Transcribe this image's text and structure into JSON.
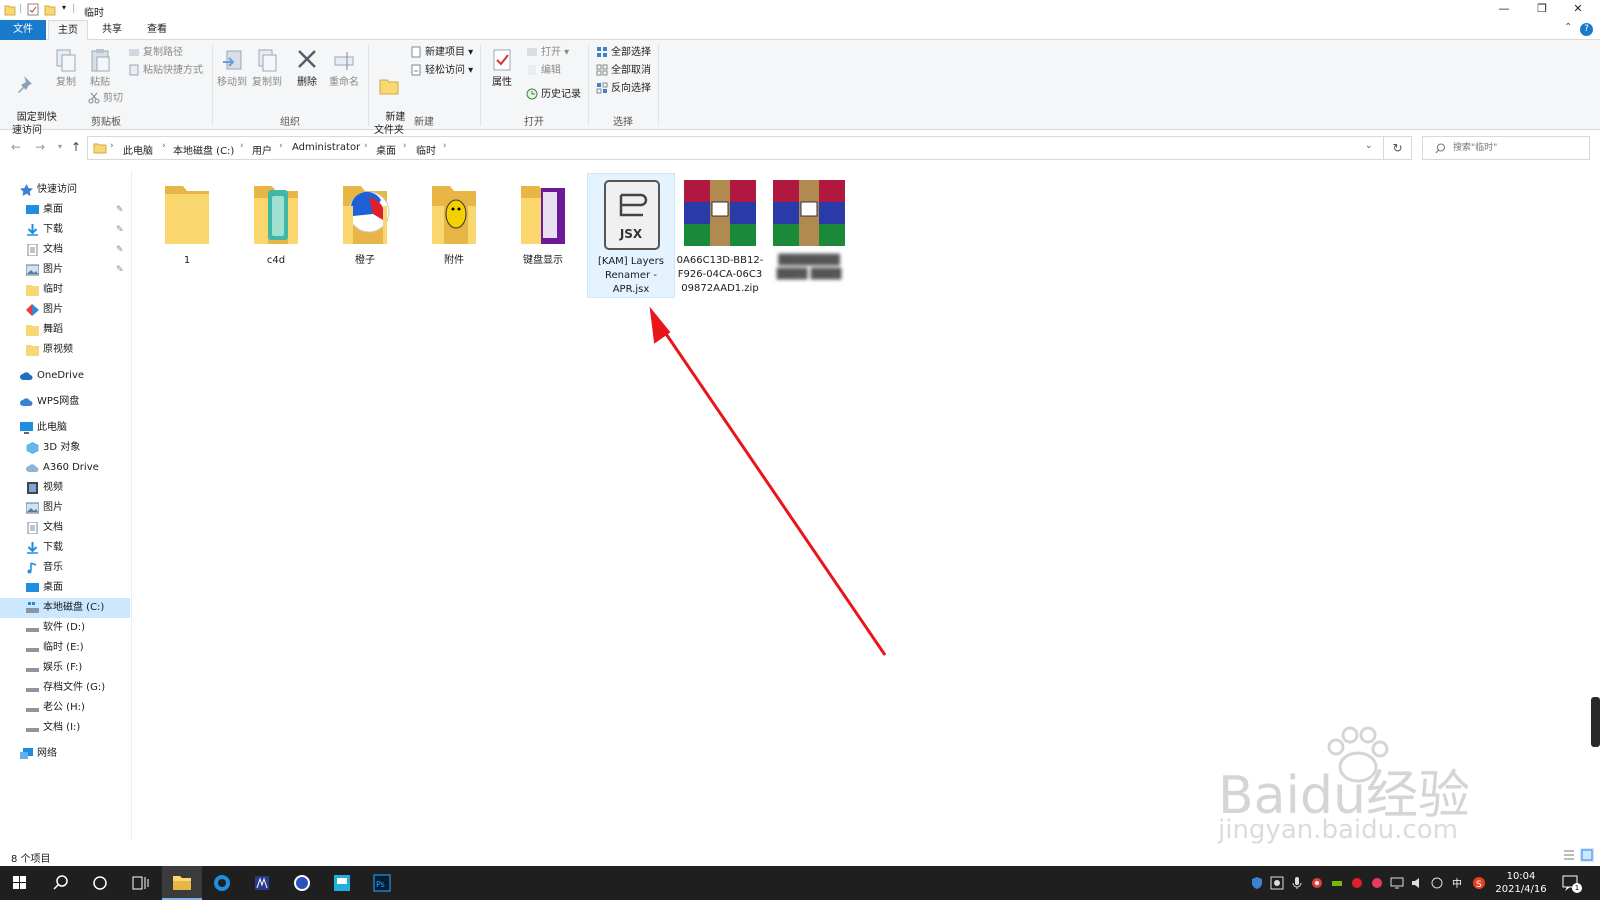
{
  "window": {
    "title": "临时",
    "minimize": "—",
    "restore": "❐",
    "close": "✕"
  },
  "tabs": {
    "file": "文件",
    "home": "主页",
    "share": "共享",
    "view": "查看"
  },
  "ribbon": {
    "clipboard": {
      "pin": "固定到快\n速访问",
      "copy": "复制",
      "paste": "粘贴",
      "copy_path": "复制路径",
      "paste_shortcut": "粘贴快捷方式",
      "cut": "剪切",
      "label": "剪贴板"
    },
    "organize": {
      "move_to": "移动到",
      "copy_to": "复制到",
      "delete": "删除",
      "rename": "重命名",
      "label": "组织"
    },
    "new": {
      "new_folder": "新建\n文件夹",
      "new_item": "新建项目",
      "easy_access": "轻松访问",
      "label": "新建"
    },
    "open": {
      "properties": "属性",
      "open": "打开",
      "edit": "编辑",
      "history": "历史记录",
      "label": "打开"
    },
    "select": {
      "select_all": "全部选择",
      "select_none": "全部取消",
      "invert": "反向选择",
      "label": "选择"
    }
  },
  "address": {
    "crumbs": [
      "此电脑",
      "本地磁盘 (C:)",
      "用户",
      "Administrator",
      "桌面",
      "临时"
    ],
    "search_placeholder": "搜索\"临时\""
  },
  "sidebar": {
    "quick_access": "快速访问",
    "quick_items": [
      "桌面",
      "下载",
      "文档",
      "图片",
      "临时",
      "图片",
      "舞蹈",
      "原视频"
    ],
    "onedrive": "OneDrive",
    "wps": "WPS网盘",
    "this_pc": "此电脑",
    "pc_items": [
      "3D 对象",
      "A360 Drive",
      "视频",
      "图片",
      "文档",
      "下载",
      "音乐",
      "桌面",
      "本地磁盘 (C:)",
      "软件 (D:)",
      "临时 (E:)",
      "娱乐 (F:)",
      "存档文件 (G:)",
      "老公 (H:)",
      "文档 (I:)"
    ],
    "network": "网络"
  },
  "files": [
    {
      "name": "1",
      "type": "folder"
    },
    {
      "name": "c4d",
      "type": "folder"
    },
    {
      "name": "橙子",
      "type": "folder"
    },
    {
      "name": "附件",
      "type": "folder"
    },
    {
      "name": "键盘显示",
      "type": "folder"
    },
    {
      "name": "[KAM] Layers Renamer - APR.jsx",
      "type": "jsx",
      "icon_label": "JSX"
    },
    {
      "name": "0A66C13D-BB12-F926-04CA-06C309872AAD1.zip",
      "type": "zip"
    },
    {
      "name": "████████ ████ ████",
      "type": "zip"
    }
  ],
  "status": {
    "count": "8 个项目"
  },
  "clock": {
    "time": "10:04",
    "date": "2021/4/16"
  },
  "tray": {
    "ime": "中",
    "notifications": "1"
  },
  "watermark": {
    "brand": "Baidu经验",
    "url": "jingyan.baidu.com"
  },
  "colors": {
    "accent": "#1979ca",
    "selection": "#cce8ff",
    "arrow": "#e8161b",
    "folder": "#f8d775"
  }
}
